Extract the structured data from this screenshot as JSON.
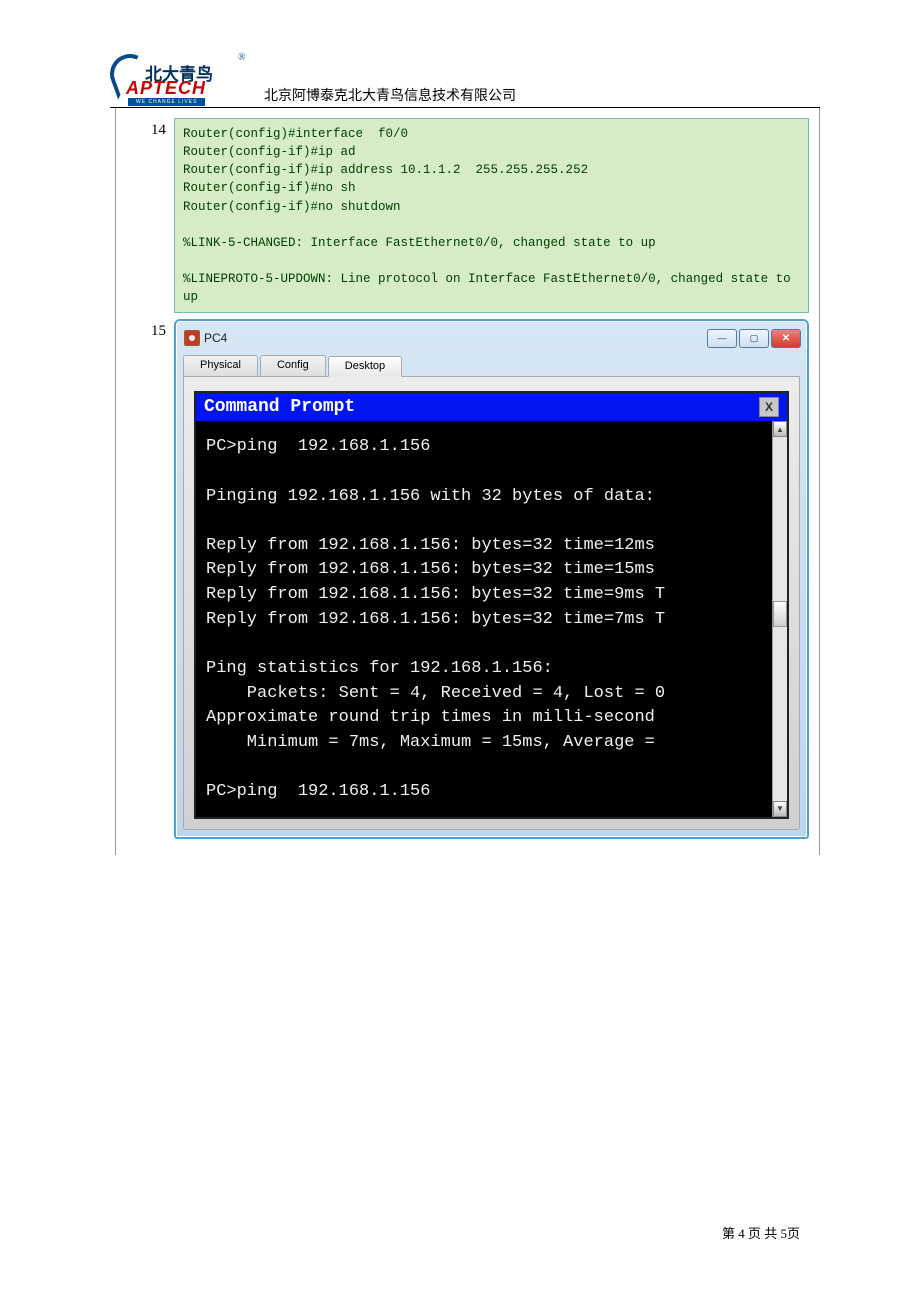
{
  "header": {
    "logo_cn": "北大青鸟",
    "logo_en": "APTECH",
    "company": "北京阿博泰克北大青鸟信息技术有限公司"
  },
  "row14": {
    "num": "14",
    "console": "Router(config)#interface  f0/0\nRouter(config-if)#ip ad\nRouter(config-if)#ip address 10.1.1.2  255.255.255.252\nRouter(config-if)#no sh\nRouter(config-if)#no shutdown\n\n%LINK-5-CHANGED: Interface FastEthernet0/0, changed state to up\n\n%LINEPROTO-5-UPDOWN: Line protocol on Interface FastEthernet0/0, changed state to up"
  },
  "row15": {
    "num": "15",
    "window_title": "PC4",
    "tabs": {
      "t1": "Physical",
      "t2": "Config",
      "t3": "Desktop"
    },
    "cmd_title": "Command Prompt",
    "cmd_close": "X",
    "cmd_body": "PC>ping  192.168.1.156\n\nPinging 192.168.1.156 with 32 bytes of data:\n\nReply from 192.168.1.156: bytes=32 time=12ms \nReply from 192.168.1.156: bytes=32 time=15ms \nReply from 192.168.1.156: bytes=32 time=9ms T\nReply from 192.168.1.156: bytes=32 time=7ms T\n\nPing statistics for 192.168.1.156:\n    Packets: Sent = 4, Received = 4, Lost = 0\nApproximate round trip times in milli-second\n    Minimum = 7ms, Maximum = 15ms, Average = \n\nPC>ping  192.168.1.156"
  },
  "footer": "第 4 页 共 5页"
}
